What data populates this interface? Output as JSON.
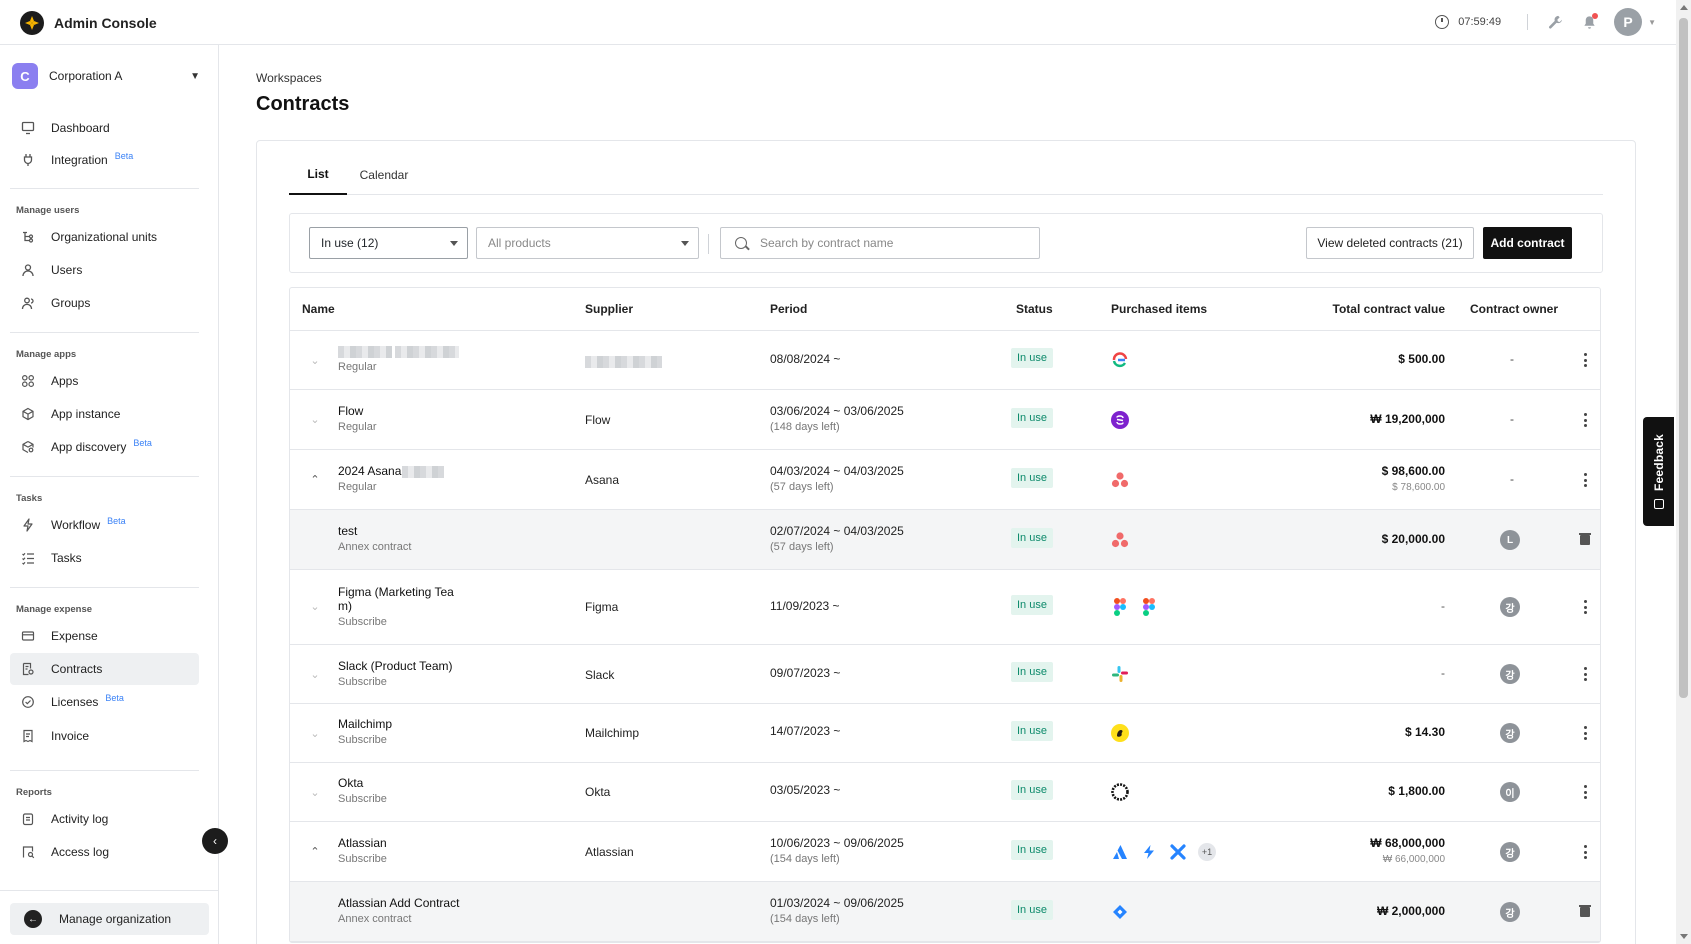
{
  "app": {
    "title": "Admin Console",
    "clock": "07:59:49",
    "user_initial": "P"
  },
  "org": {
    "initial": "C",
    "name": "Corporation A"
  },
  "sidebar": {
    "items": [
      {
        "label": "Dashboard"
      },
      {
        "label": "Integration",
        "badge": "Beta"
      },
      {
        "label": "Organizational units"
      },
      {
        "label": "Users"
      },
      {
        "label": "Groups"
      },
      {
        "label": "Apps"
      },
      {
        "label": "App instance"
      },
      {
        "label": "App discovery",
        "badge": "Beta"
      },
      {
        "label": "Workflow",
        "badge": "Beta"
      },
      {
        "label": "Tasks"
      },
      {
        "label": "Expense"
      },
      {
        "label": "Contracts"
      },
      {
        "label": "Licenses",
        "badge": "Beta"
      },
      {
        "label": "Invoice"
      },
      {
        "label": "Activity log"
      },
      {
        "label": "Access log"
      }
    ],
    "sections": [
      "Manage users",
      "Manage apps",
      "Tasks",
      "Manage expense",
      "Reports"
    ],
    "manage_org": "Manage organization"
  },
  "page": {
    "breadcrumb": "Workspaces",
    "title": "Contracts"
  },
  "tabs": [
    "List",
    "Calendar"
  ],
  "filters": {
    "status": "In use (12)",
    "products": "All products",
    "search_placeholder": "Search by contract name",
    "deleted_label": "View deleted contracts (21)",
    "add_label": "Add contract"
  },
  "table": {
    "headers": [
      "Name",
      "Supplier",
      "Period",
      "Status",
      "Purchased items",
      "Total contract value",
      "Contract owner"
    ],
    "rows": [
      {
        "name": "",
        "type": "Regular",
        "supplier": "",
        "period": "08/08/2024 ~",
        "period_sub": "",
        "status": "In use",
        "value": "$ 500.00",
        "value_sub": "",
        "owner": "-"
      },
      {
        "name": "Flow",
        "type": "Regular",
        "supplier": "Flow",
        "period": "03/06/2024 ~ 03/06/2025",
        "period_sub": "(148 days left)",
        "status": "In use",
        "value": "₩ 19,200,000",
        "value_sub": "",
        "owner": "-"
      },
      {
        "name": "2024 Asana",
        "type": "Regular",
        "supplier": "Asana",
        "period": "04/03/2024 ~ 04/03/2025",
        "period_sub": "(57 days left)",
        "status": "In use",
        "value": "$ 98,600.00",
        "value_sub": "$ 78,600.00",
        "owner": "-"
      },
      {
        "name": "test",
        "type": "Annex contract",
        "supplier": "",
        "period": "02/07/2024 ~ 04/03/2025",
        "period_sub": "(57 days left)",
        "status": "In use",
        "value": "$ 20,000.00",
        "value_sub": "",
        "owner": "L"
      },
      {
        "name": "Figma (Marketing Tea m)",
        "type": "Subscribe",
        "supplier": "Figma",
        "period": "11/09/2023 ~",
        "period_sub": "",
        "status": "In use",
        "value": "-",
        "value_sub": "",
        "owner": "강"
      },
      {
        "name": "Slack (Product Team)",
        "type": "Subscribe",
        "supplier": "Slack",
        "period": "09/07/2023 ~",
        "period_sub": "",
        "status": "In use",
        "value": "-",
        "value_sub": "",
        "owner": "강"
      },
      {
        "name": "Mailchimp",
        "type": "Subscribe",
        "supplier": "Mailchimp",
        "period": "14/07/2023 ~",
        "period_sub": "",
        "status": "In use",
        "value": "$ 14.30",
        "value_sub": "",
        "owner": "강"
      },
      {
        "name": "Okta",
        "type": "Subscribe",
        "supplier": "Okta",
        "period": "03/05/2023 ~",
        "period_sub": "",
        "status": "In use",
        "value": "$ 1,800.00",
        "value_sub": "",
        "owner": "이"
      },
      {
        "name": "Atlassian",
        "type": "Subscribe",
        "supplier": "Atlassian",
        "period": "10/06/2023 ~ 09/06/2025",
        "period_sub": "(154 days left)",
        "status": "In use",
        "value": "₩ 68,000,000",
        "value_sub": "₩ 66,000,000",
        "owner": "강",
        "more_items": "+1"
      },
      {
        "name": "Atlassian Add Contract",
        "type": "Annex contract",
        "supplier": "",
        "period": "01/03/2024 ~ 09/06/2025",
        "period_sub": "(154 days left)",
        "status": "In use",
        "value": "₩ 2,000,000",
        "value_sub": "",
        "owner": "강"
      }
    ]
  },
  "feedback": {
    "label": "Feedback"
  },
  "colors": {
    "accent": "#111111",
    "status_text": "#0d8a6b",
    "status_bg": "#e3f4ee",
    "org_badge": "#8b7ff0",
    "beta": "#3b82f6"
  }
}
